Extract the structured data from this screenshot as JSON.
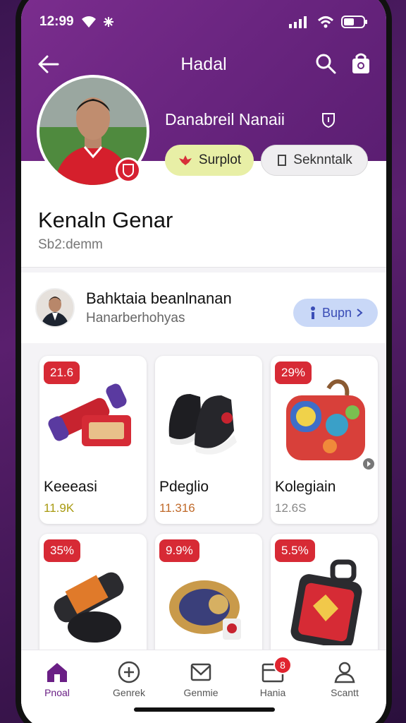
{
  "status_bar": {
    "time": "12:99",
    "signal_icon": "signal-icon",
    "wifi_icon": "wifi-icon",
    "battery_icon": "battery-icon"
  },
  "header": {
    "title": "Hadal"
  },
  "profile": {
    "display_name": "Danabreil Nanaii",
    "follow_label": "Surplot",
    "message_label": "Seknntalk",
    "full_name": "Kenaln Genar",
    "handle": "Sb2:demm"
  },
  "coach": {
    "name": "Bahktaia beanlnanan",
    "subtitle": "Hanarberhohyas",
    "button_label": "Bupn"
  },
  "products": [
    {
      "badge": "21.6",
      "name": "Keeeasi",
      "price": "11.9K",
      "price_color": "#a89a10",
      "icon": "scarf-icon"
    },
    {
      "badge": "",
      "name": "Pdeglio",
      "price": "11.316",
      "price_color": "#c06a2a",
      "icon": "boots-icon"
    },
    {
      "badge": "29%",
      "name": "Kolegiain",
      "price": "12.6S",
      "price_color": "#888888",
      "icon": "bag-icon"
    },
    {
      "badge": "35%",
      "name": "",
      "price": "",
      "price_color": "#888888",
      "icon": "bottle-icon"
    },
    {
      "badge": "9.9%",
      "name": "",
      "price": "",
      "price_color": "#888888",
      "icon": "belt-icon"
    },
    {
      "badge": "5.5%",
      "name": "",
      "price": "",
      "price_color": "#888888",
      "icon": "luggage-tag-icon"
    }
  ],
  "tabbar": {
    "items": [
      {
        "label": "Pnoal",
        "icon": "home-icon"
      },
      {
        "label": "Genrek",
        "icon": "plus-circle-icon"
      },
      {
        "label": "Genmie",
        "icon": "mail-icon"
      },
      {
        "label": "Hania",
        "icon": "cart-icon",
        "badge": "8"
      },
      {
        "label": "Scantt",
        "icon": "user-icon"
      }
    ]
  },
  "colors": {
    "accent": "#6a2580",
    "follow_bg": "#e8efa6",
    "join_bg": "#c9d8f7",
    "sale_badge": "#d72a35"
  }
}
